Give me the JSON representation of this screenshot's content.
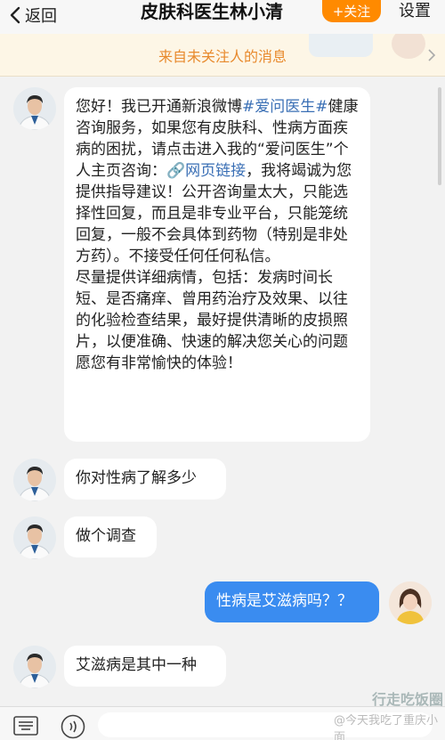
{
  "header": {
    "back_label": "返回",
    "title": "皮肤科医生林小清",
    "follow_label": "+关注",
    "settings_label": "设置"
  },
  "notice": {
    "text": "来自未关注人的消息"
  },
  "messages": [
    {
      "from": "doctor",
      "paragraphs": [
        "您好！我已开通新浪微博",
        "#爱问医生#",
        "健康咨询服务，如果您有皮肤科、性病方面疾病的困扰，请点击进入我的“爱问医生”个人主页咨询：",
        "🔗网页链接",
        "，我将竭诚为您提供指导建议！公开咨询量太大，只能选择性回复，而且是非专业平台，只能笼统回复，一般不会具体到药物（特别是非处方药）。不接受任何任何私信。",
        "尽量提供详细病情，包括：发病时间长短、是否痛痒、曾用药治疗及效果、以往的化验检查结果，最好提供清晰的皮损照片，以便准确、快速的解决您关心的问题",
        "愿您有非常愉快的体验！"
      ]
    },
    {
      "from": "doctor",
      "text": "你对性病了解多少"
    },
    {
      "from": "doctor",
      "text": "做个调查"
    },
    {
      "from": "me",
      "text": "性病是艾滋病吗？？"
    },
    {
      "from": "doctor",
      "text": "艾滋病是其中一种"
    }
  ],
  "watermark": {
    "text": "@今天我吃了重庆小面",
    "logo_text": "行走吃饭圈"
  },
  "colors": {
    "accent_orange": "#ff8a00",
    "link_blue": "#3a6fb5",
    "my_bubble": "#3a8cf0"
  },
  "icons": [
    "back-chevron-icon",
    "chevron-right-icon",
    "keyboard-icon",
    "voice-icon",
    "link-icon"
  ]
}
